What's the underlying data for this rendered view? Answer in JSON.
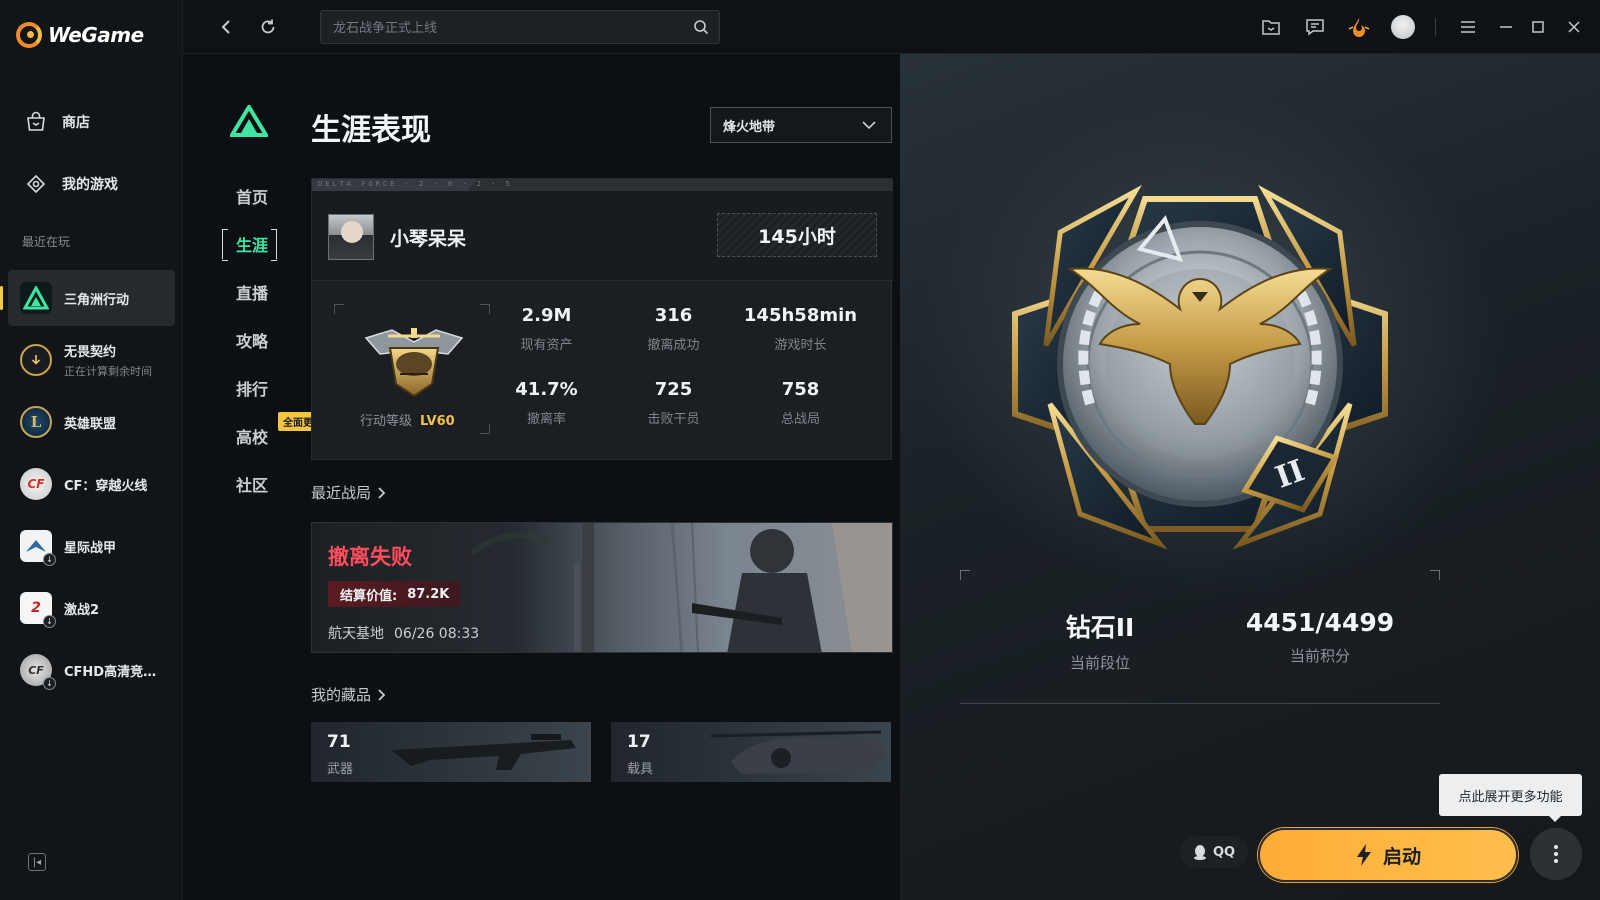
{
  "app": {
    "brand": "WeGame"
  },
  "sidebar": {
    "nav": [
      {
        "label": "商店",
        "icon": "bag-icon"
      },
      {
        "label": "我的游戏",
        "icon": "gamepad-icon"
      }
    ],
    "recent_title": "最近在玩",
    "games": [
      {
        "name": "三角洲行动",
        "sub": "",
        "active": true
      },
      {
        "name": "无畏契约",
        "sub": "正在计算剩余时间"
      },
      {
        "name": "英雄联盟",
        "sub": ""
      },
      {
        "name": "CF：穿越火线",
        "sub": ""
      },
      {
        "name": "星际战甲",
        "sub": ""
      },
      {
        "name": "激战2",
        "sub": ""
      },
      {
        "name": "CFHD高清竞技...",
        "sub": ""
      }
    ]
  },
  "topbar": {
    "search_placeholder": "龙石战争正式上线",
    "icons": [
      "folder-icon",
      "chat-icon",
      "fire-icon",
      "avatar",
      "menu-icon",
      "minimize-icon",
      "maximize-icon",
      "close-icon"
    ]
  },
  "section_nav": {
    "items": [
      "首页",
      "生涯",
      "直播",
      "攻略",
      "排行",
      "高校",
      "社区"
    ],
    "active": "生涯",
    "update_badge": "全面更新"
  },
  "career": {
    "title": "生涯表现",
    "mode": "烽火地带",
    "strip_text": "DELTA FORCE · 2 · 0 · 2 · 5",
    "player_name": "小琴呆呆",
    "hours": "145小时",
    "rank_level_label": "行动等级",
    "rank_level": "LV60",
    "stats": [
      {
        "value": "2.9M",
        "label": "现有资产"
      },
      {
        "value": "316",
        "label": "撤离成功"
      },
      {
        "value": "145h58min",
        "label": "游戏时长"
      },
      {
        "value": "41.7%",
        "label": "撤离率"
      },
      {
        "value": "725",
        "label": "击败干员"
      },
      {
        "value": "758",
        "label": "总战局"
      }
    ]
  },
  "recent_matches": {
    "title": "最近战局",
    "result": "撤离失败",
    "value_label": "结算价值:",
    "value": "87.2K",
    "map": "航天基地",
    "time": "06/26 08:33"
  },
  "collection": {
    "title": "我的藏品",
    "items": [
      {
        "count": "71",
        "label": "武器"
      },
      {
        "count": "17",
        "label": "载具"
      }
    ]
  },
  "hero": {
    "rank_name": "钻石II",
    "rank_label": "当前段位",
    "score": "4451/4499",
    "score_label": "当前积分"
  },
  "actions": {
    "tooltip": "点此展开更多功能",
    "qq": "QQ",
    "launch": "启动"
  },
  "colors": {
    "accent_green": "#3fe6a3",
    "launch_orange": "#ffb340",
    "fail_red": "#ff4d5c",
    "level_gold": "#f3c14a"
  }
}
